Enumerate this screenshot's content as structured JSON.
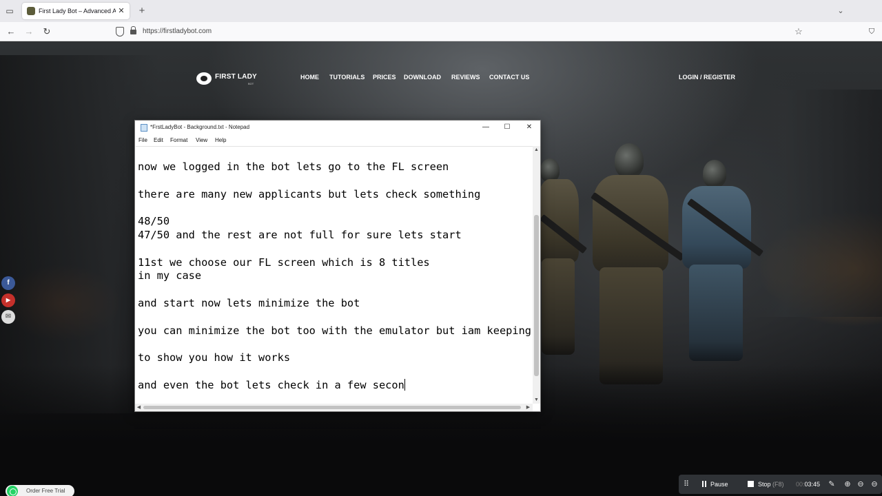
{
  "browser": {
    "tab_title": "First Lady Bot – Advanced Auto",
    "tab_close": "✕",
    "new_tab": "+",
    "tabs_dropdown": "⌄",
    "url": "https://firstladybot.com",
    "icons": [
      "tab-list-icon",
      "back-icon",
      "forward-icon",
      "reload-icon",
      "shield-icon",
      "lock-icon",
      "star-icon",
      "pocket-icon"
    ]
  },
  "site": {
    "logo": "FIRST LADY",
    "logo_sub": "BOT",
    "nav": [
      "HOME",
      "TUTORIALS",
      "PRICES",
      "DOWNLOAD",
      "REVIEWS",
      "CONTACT US"
    ],
    "login": "LOGIN / REGISTER",
    "social": [
      {
        "name": "facebook",
        "glyph": "f",
        "color": "#3b5998"
      },
      {
        "name": "youtube",
        "glyph": "▶",
        "color": "#c4302b"
      },
      {
        "name": "email",
        "glyph": "✉",
        "color": "#dddddd"
      }
    ],
    "order_trial": "Order Free Trial"
  },
  "notepad": {
    "title": "*FrstLadyBot - Background.txt - Notepad",
    "controls": {
      "minimize": "—",
      "maximize": "☐",
      "close": "✕"
    },
    "menu": [
      "File",
      "Edit",
      "Format",
      "View",
      "Help"
    ],
    "lines": [
      "now we logged in the bot lets go to the FL screen",
      "",
      "there are many new applicants but lets check something",
      "",
      "48/50",
      "47/50 and the rest are not full for sure lets start",
      "",
      "11st we choose our FL screen which is 8 titles",
      "in my case",
      "",
      "and start now lets minimize the bot",
      "",
      "you can minimize the bot too with the emulator but iam keeping",
      "",
      "to show you how it works",
      "",
      "and even the bot lets check in a few secon"
    ]
  },
  "recorder": {
    "pause": "Pause",
    "stop": "Stop",
    "stop_key": "(F8)",
    "time_prefix": "00:",
    "time": "03:45"
  }
}
